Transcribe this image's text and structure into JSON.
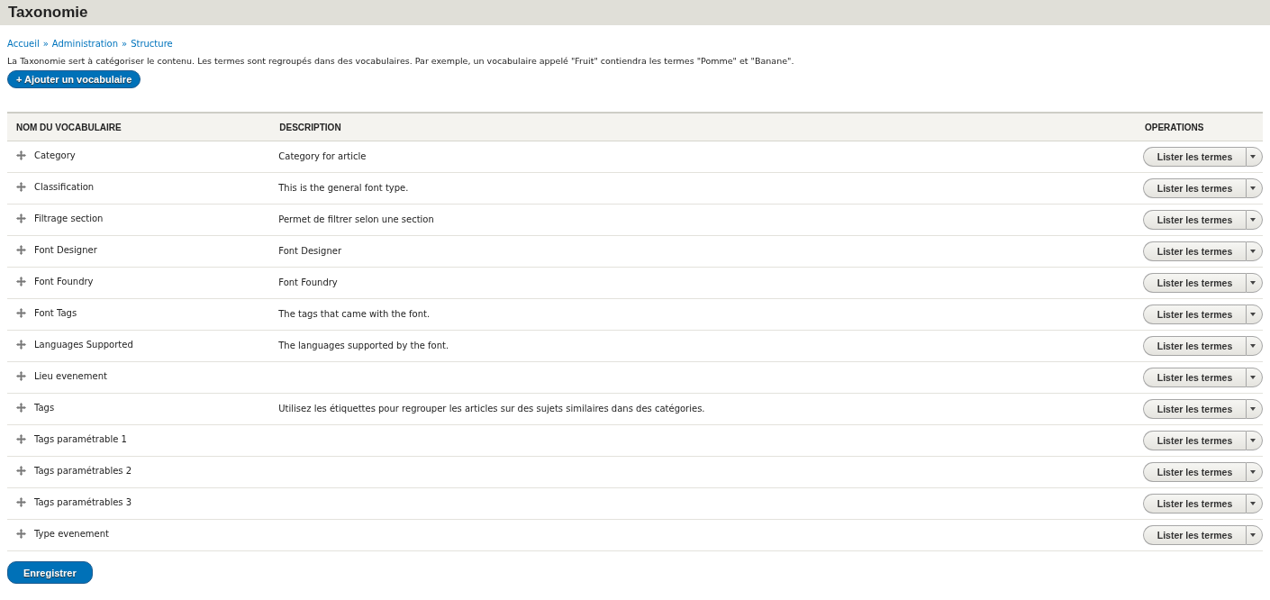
{
  "page": {
    "title": "Taxonomie"
  },
  "breadcrumb": [
    "Accueil",
    "Administration",
    "Structure"
  ],
  "breadcrumb_separator": "»",
  "intro": "La Taxonomie sert à catégoriser le contenu. Les termes sont regroupés dans des vocabulaires. Par exemple, un vocabulaire appelé \"Fruit\" contiendra les termes \"Pomme\" et \"Banane\".",
  "add_button": "+ Ajouter un vocabulaire",
  "table": {
    "columns": [
      "NOM DU VOCABULAIRE",
      "DESCRIPTION",
      "OPERATIONS"
    ],
    "rows": [
      {
        "name": "Category",
        "description": "Category for article",
        "operation": "Lister les termes"
      },
      {
        "name": "Classification",
        "description": "This is the general font type.",
        "operation": "Lister les termes"
      },
      {
        "name": "Filtrage section",
        "description": "Permet de filtrer selon une section",
        "operation": "Lister les termes"
      },
      {
        "name": "Font Designer",
        "description": "Font Designer",
        "operation": "Lister les termes"
      },
      {
        "name": "Font Foundry",
        "description": "Font Foundry",
        "operation": "Lister les termes"
      },
      {
        "name": "Font Tags",
        "description": "The tags that came with the font.",
        "operation": "Lister les termes"
      },
      {
        "name": "Languages Supported",
        "description": "The languages supported by the font.",
        "operation": "Lister les termes"
      },
      {
        "name": "Lieu evenement",
        "operation": "Lister les termes"
      },
      {
        "name": "Tags",
        "description": "Utilisez les étiquettes pour regrouper les articles sur des sujets similaires dans des catégories.",
        "operation": "Lister les termes"
      },
      {
        "name": "Tags paramétrable 1",
        "operation": "Lister les termes"
      },
      {
        "name": "Tags paramétrables 2",
        "operation": "Lister les termes"
      },
      {
        "name": "Tags paramétrables 3",
        "operation": "Lister les termes"
      },
      {
        "name": "Type evenement",
        "operation": "Lister les termes"
      }
    ]
  },
  "save_button": "Enregistrer"
}
